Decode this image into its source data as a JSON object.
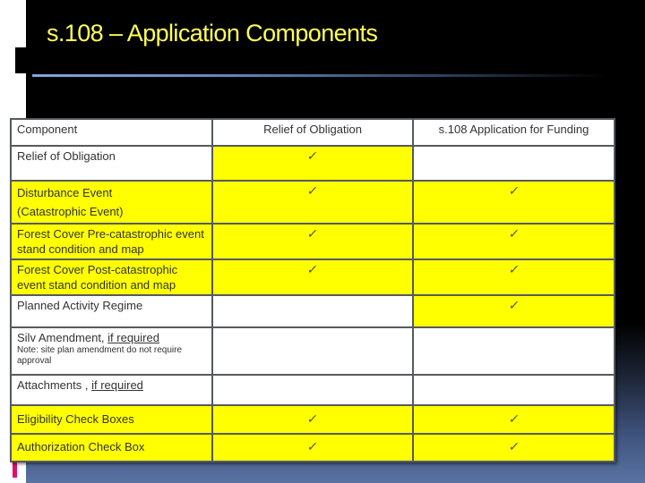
{
  "slide": {
    "title": "s.108 – Application Components",
    "colors": {
      "title": "#ffff55",
      "highlight": "#ffff00",
      "background_top": "#000000",
      "background_bottom": "#5a73a3",
      "accent_bar": "#e0106e"
    }
  },
  "table": {
    "headers": [
      "Component",
      "Relief of Obligation",
      "s.108 Application for Funding"
    ],
    "check_icon": "✓",
    "rows": [
      {
        "component": "Relief of Obligation",
        "note": "",
        "suffix": "",
        "relief": "✓",
        "funding": ""
      },
      {
        "component": "Disturbance Event",
        "component_line2": "(Catastrophic Event)",
        "relief": "✓",
        "funding": "✓"
      },
      {
        "component": "Forest Cover Pre-catastrophic event stand condition and map",
        "relief": "✓",
        "funding": "✓"
      },
      {
        "component": "Forest Cover Post-catastrophic event stand condition and map",
        "relief": "✓",
        "funding": "✓"
      },
      {
        "component": "Planned Activity Regime",
        "relief": "",
        "funding": "✓"
      },
      {
        "component": "Silv Amendment, ",
        "suffix": "if required",
        "note": "Note: site plan amendment  do not require approval",
        "relief": "",
        "funding": ""
      },
      {
        "component": "Attachments , ",
        "suffix": "if required",
        "relief": "",
        "funding": ""
      },
      {
        "component": "Eligibility Check Boxes",
        "relief": "✓",
        "funding": "✓"
      },
      {
        "component": "Authorization Check Box",
        "relief": "✓",
        "funding": "✓"
      }
    ]
  }
}
